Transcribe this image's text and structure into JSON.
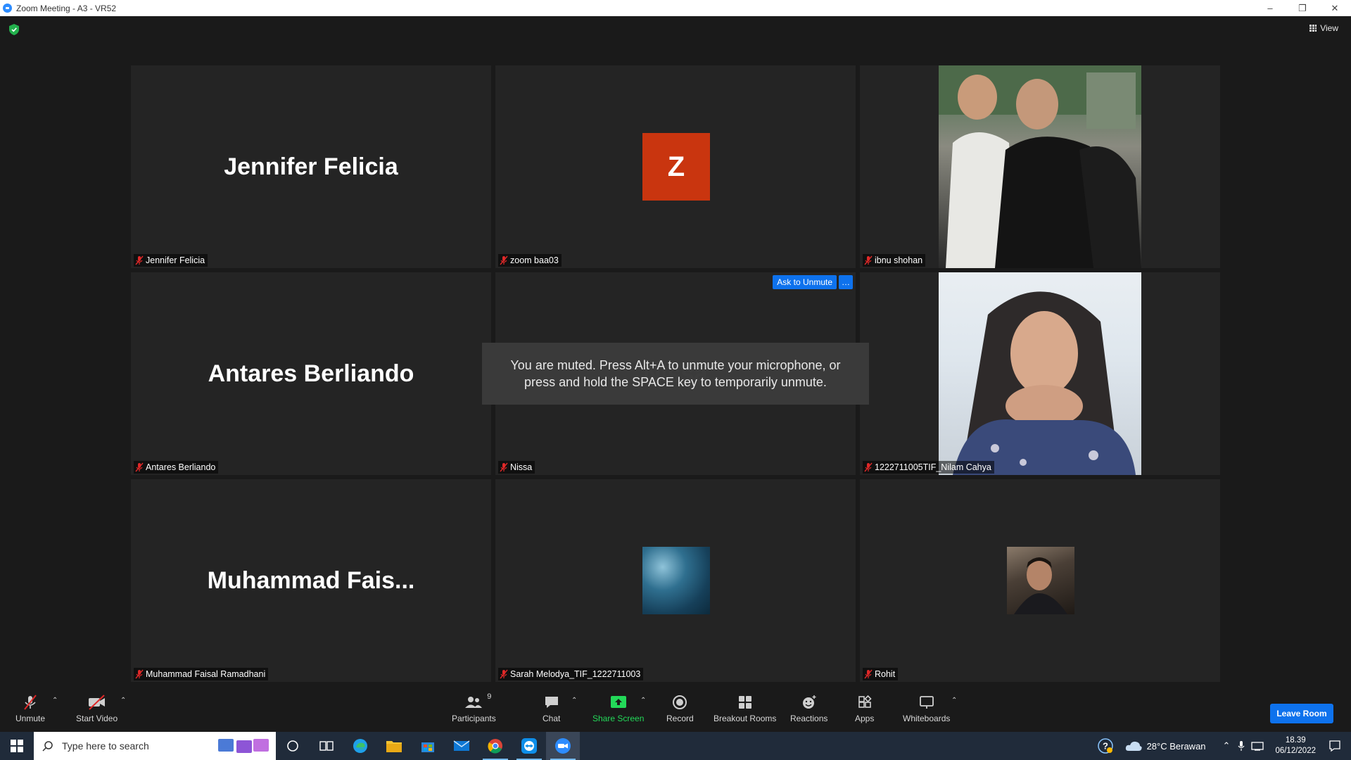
{
  "window": {
    "title": "Zoom Meeting - A3 - VR52"
  },
  "meeting": {
    "view_label": "View",
    "toast": "You are muted. Press Alt+A to unmute your microphone, or press and hold the SPACE key to temporarily unmute.",
    "ask_to_unmute": "Ask to Unmute",
    "more_label": "…",
    "tiles": [
      {
        "display_name": "Jennifer Felicia",
        "label": "Jennifer Felicia",
        "type": "name"
      },
      {
        "display_name": "Z",
        "label": "zoom baa03",
        "type": "avatar"
      },
      {
        "label": "ibnu shohan",
        "type": "photo"
      },
      {
        "display_name": "Antares Berliando",
        "label": "Antares Berliando",
        "type": "name"
      },
      {
        "display_name": "Nissa",
        "label": "Nissa",
        "type": "hidden-name"
      },
      {
        "label": "1222711005TIF_Nilam Cahya",
        "type": "photo"
      },
      {
        "display_name": "Muhammad  Fais...",
        "label": "Muhammad Faisal Ramadhani",
        "type": "name"
      },
      {
        "label": "Sarah Melodya_TIF_1222711003",
        "type": "thumb"
      },
      {
        "label": "Rohit",
        "type": "thumb"
      }
    ]
  },
  "toolbar": {
    "unmute": "Unmute",
    "start_video": "Start Video",
    "participants": "Participants",
    "participants_count": "9",
    "chat": "Chat",
    "share_screen": "Share Screen",
    "record": "Record",
    "breakout_rooms": "Breakout Rooms",
    "reactions": "Reactions",
    "apps": "Apps",
    "whiteboards": "Whiteboards",
    "leave_room": "Leave Room"
  },
  "taskbar": {
    "search_placeholder": "Type here to search",
    "weather": "28°C  Berawan",
    "time": "18.39",
    "date": "06/12/2022"
  },
  "colors": {
    "zoom_blue": "#0e72ed",
    "mute_red": "#e02828",
    "share_green": "#23d959",
    "avatar_orange": "#c9350f"
  }
}
